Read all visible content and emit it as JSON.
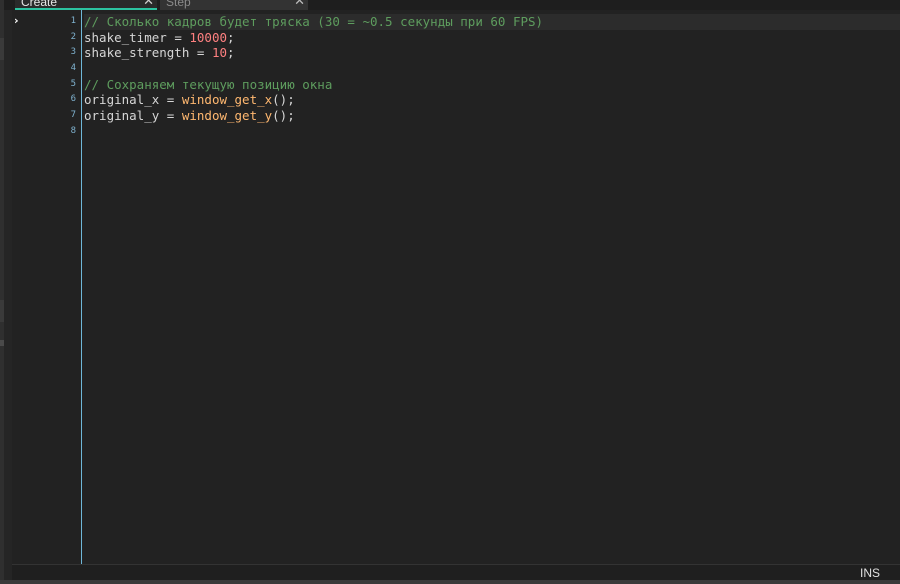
{
  "tabs": [
    {
      "label": "Create",
      "close": "✕",
      "active": true
    },
    {
      "label": "Step",
      "close": "✕",
      "active": false
    }
  ],
  "editor": {
    "caret_marker": "›",
    "line_numbers": [
      "1",
      "2",
      "3",
      "4",
      "5",
      "6",
      "7",
      "8"
    ],
    "lines": [
      [
        {
          "t": "comment",
          "v": "// Сколько кадров будет тряска (30 = ~0.5 секунды при 60 FPS)"
        }
      ],
      [
        {
          "t": "ident",
          "v": "shake_timer"
        },
        {
          "t": "op",
          "v": " = "
        },
        {
          "t": "num",
          "v": "10000"
        },
        {
          "t": "punct",
          "v": ";"
        }
      ],
      [
        {
          "t": "ident",
          "v": "shake_strength"
        },
        {
          "t": "op",
          "v": " = "
        },
        {
          "t": "num",
          "v": "10"
        },
        {
          "t": "punct",
          "v": ";"
        }
      ],
      [],
      [
        {
          "t": "comment",
          "v": "// Сохраняем текущую позицию окна"
        }
      ],
      [
        {
          "t": "ident",
          "v": "original_x"
        },
        {
          "t": "op",
          "v": " = "
        },
        {
          "t": "func",
          "v": "window_get_x"
        },
        {
          "t": "punct",
          "v": "();"
        }
      ],
      [
        {
          "t": "ident",
          "v": "original_y"
        },
        {
          "t": "op",
          "v": " = "
        },
        {
          "t": "func",
          "v": "window_get_y"
        },
        {
          "t": "punct",
          "v": "();"
        }
      ],
      []
    ]
  },
  "statusbar": {
    "mode": "INS"
  },
  "colors": {
    "accent": "#2cc3a0",
    "gutter_line": "#6fb7d8",
    "comment": "#5e9d5e",
    "number": "#ff8080",
    "function": "#ffb870"
  }
}
